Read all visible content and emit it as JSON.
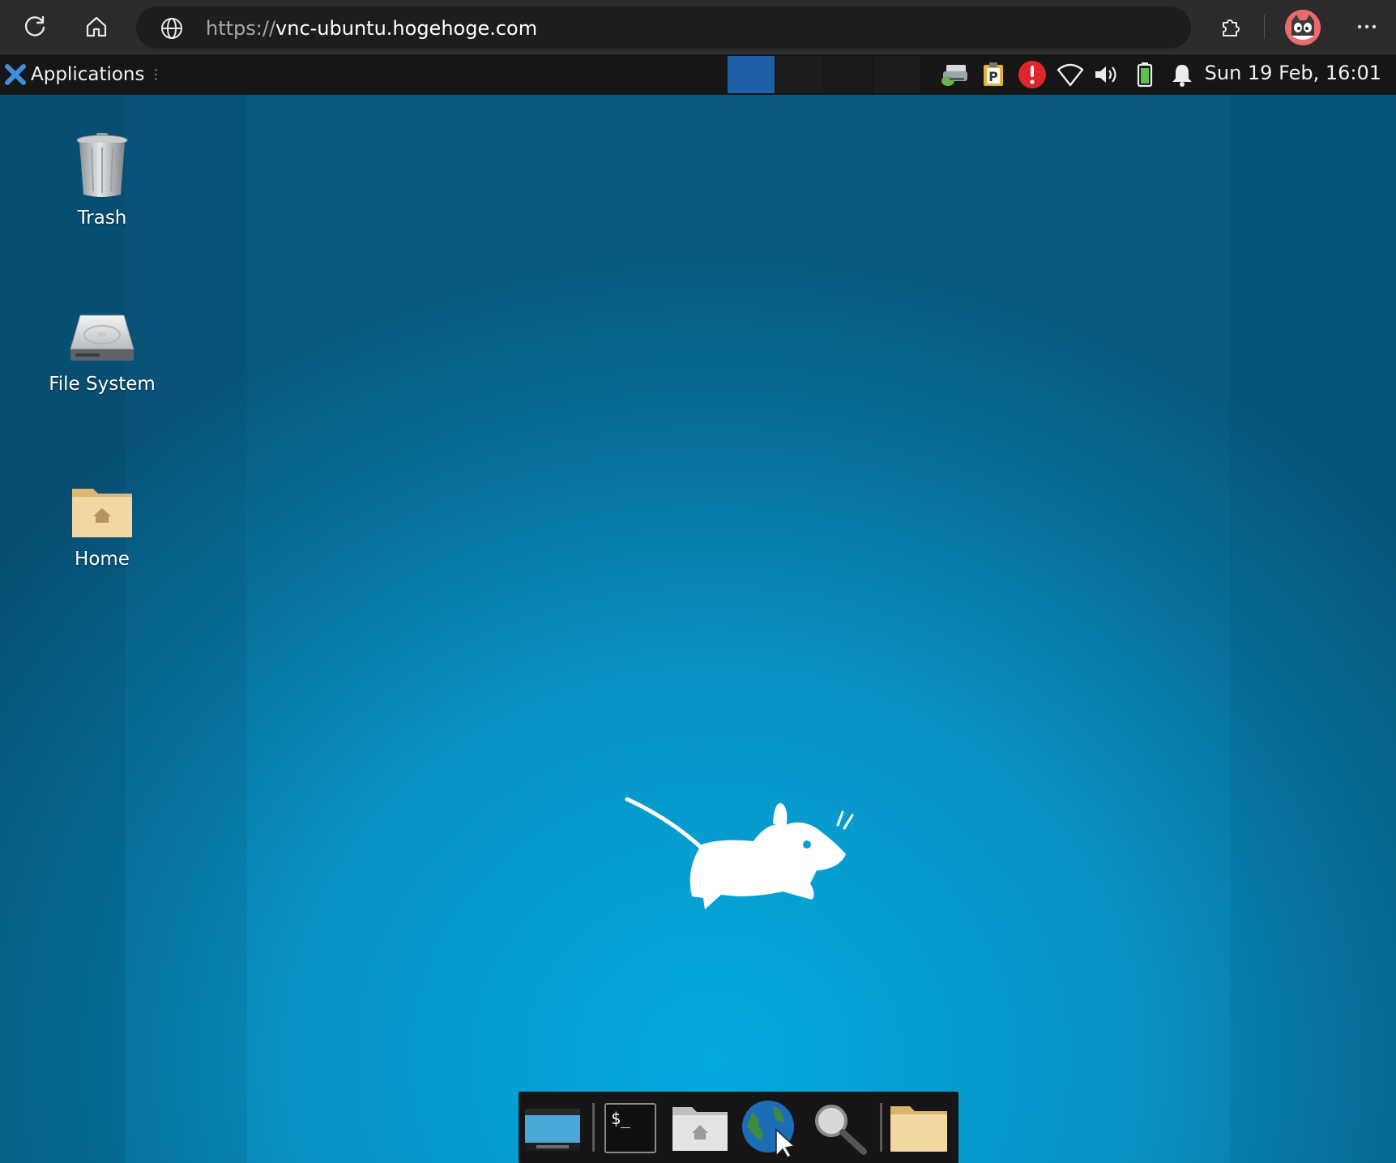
{
  "browser": {
    "url_scheme": "https://",
    "url_host": "vnc-ubuntu.hogehoge.com",
    "icons": [
      "reload-icon",
      "home-icon",
      "globe-icon",
      "extensions-icon",
      "profile-avatar",
      "more-menu-icon"
    ]
  },
  "panel": {
    "applications_label": "Applications",
    "clock": "Sun 19 Feb, 16:01",
    "workspaces": 4,
    "active_workspace": 1,
    "tray_icons": [
      "network-printer-icon",
      "clipboard-icon",
      "error-alert-icon",
      "wifi-icon",
      "volume-icon",
      "battery-icon",
      "notification-bell-icon"
    ]
  },
  "desktop": {
    "icons": [
      {
        "label": "Trash"
      },
      {
        "label": "File System"
      },
      {
        "label": "Home"
      }
    ]
  },
  "dock": {
    "items": [
      "show-desktop",
      "terminal",
      "home-folder",
      "web-browser",
      "search",
      "files"
    ]
  },
  "colors": {
    "accent_blue": "#1f5fa8",
    "desktop_center": "#04a9e0",
    "desktop_edge": "#08577c",
    "panel_bg": "#161616"
  }
}
